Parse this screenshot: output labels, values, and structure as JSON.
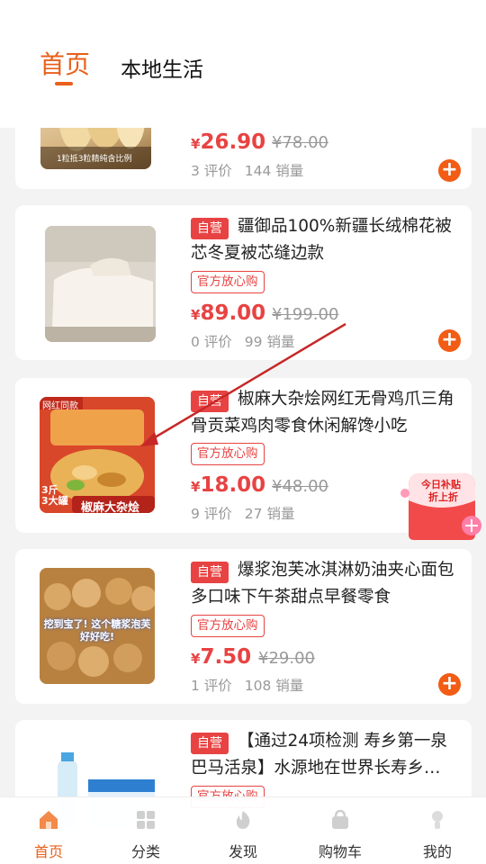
{
  "header": {
    "tabs": [
      {
        "label": "首页",
        "active": true
      },
      {
        "label": "本地生活",
        "active": false
      }
    ],
    "accent_color": "#e8601c"
  },
  "products": [
    {
      "price_symbol": "¥",
      "price": "26.90",
      "original_price": "¥78.00",
      "reviews": "3 评价",
      "sales": "144 销量",
      "thumb_caption": "1粒抵3粒精纯含比例"
    },
    {
      "tag": "自营",
      "title": "疆御品100%新疆长绒棉花被芯冬夏被芯缝边款",
      "badge": "官方放心购",
      "price_symbol": "¥",
      "price": "89.00",
      "original_price": "¥199.00",
      "reviews": "0 评价",
      "sales": "99 销量"
    },
    {
      "tag": "自营",
      "title": "椒麻大杂烩网红无骨鸡爪三角骨贡菜鸡肉零食休闲解馋小吃",
      "badge": "官方放心购",
      "price_symbol": "¥",
      "price": "18.00",
      "original_price": "¥48.00",
      "reviews": "9 评价",
      "sales": "27 销量",
      "thumb_label_top": "网红同款",
      "thumb_label_weight": "3斤",
      "thumb_label_count": "3大罐",
      "thumb_label_name": "椒麻大杂烩"
    },
    {
      "tag": "自营",
      "title": "爆浆泡芙冰淇淋奶油夹心面包多口味下午茶甜点早餐零食",
      "badge": "官方放心购",
      "price_symbol": "¥",
      "price": "7.50",
      "original_price": "¥29.00",
      "reviews": "1 评价",
      "sales": "108 销量",
      "thumb_caption": "挖到宝了! 这个糖浆泡芙好好吃!"
    },
    {
      "tag": "自营",
      "title": "【通过24项检测 寿乡第一泉巴马活泉】水源地在世界长寿乡…",
      "badge": "官方放心购"
    }
  ],
  "promo": {
    "line1": "今日补贴",
    "line2": "折上折"
  },
  "bottom_nav": [
    {
      "label": "首页",
      "icon": "home-icon",
      "active": true
    },
    {
      "label": "分类",
      "icon": "category-icon",
      "active": false
    },
    {
      "label": "发现",
      "icon": "discover-icon",
      "active": false
    },
    {
      "label": "购物车",
      "icon": "cart-icon",
      "active": false
    },
    {
      "label": "我的",
      "icon": "profile-icon",
      "active": false
    }
  ],
  "colors": {
    "price_red": "#e84343",
    "add_button": "#f25c14"
  }
}
